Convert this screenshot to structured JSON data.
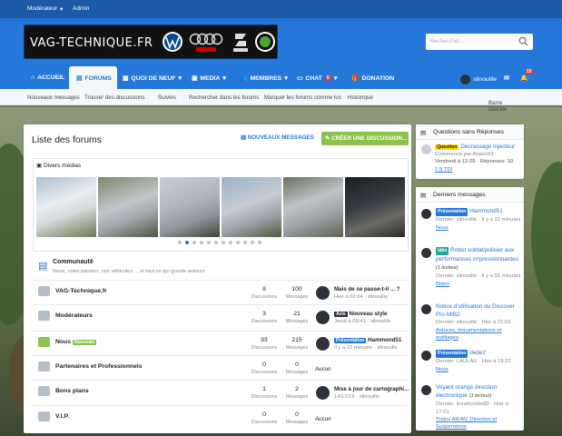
{
  "topbar": {
    "moderator": "Modérateur",
    "admin": "Admin"
  },
  "logo": {
    "text": "VAG-TECHNIQUE.FR",
    "brands": [
      "vw-logo",
      "audi-logo",
      "seat-logo",
      "skoda-logo"
    ]
  },
  "search": {
    "placeholder": "Rechercher..."
  },
  "nav": {
    "items": [
      "ACCUEIL",
      "FORUMS",
      "QUOI DE NEUF",
      "MEDIA",
      "MEMBRES",
      "CHAT",
      "DONATION"
    ],
    "chat_badge": "0",
    "user": "slinouille",
    "alert_badge": "15"
  },
  "subnav": {
    "items": [
      "Nouveaux messages",
      "Trouver des discussions",
      "Suivies",
      "Rechercher dans les forums",
      "Marquer les forums comme lus",
      "Historique"
    ],
    "sidebar_toggle": "Barre latérale"
  },
  "main": {
    "title": "Liste des forums",
    "new_messages": "NOUVEAUX MESSAGES",
    "create": "CRÉER UNE DISCUSSION...",
    "media_title": "Divers médias",
    "community_title": "Communauté",
    "community_desc": "Nous, notre passion, nos véhicules ... et tout ce qui gravite autours"
  },
  "colors": {
    "brand": "#2577d9",
    "dark": "#1c5aa7",
    "green": "#8bc34a"
  },
  "forums": [
    {
      "title": "VAG-Technique.fr",
      "tag": "",
      "discussions": "8",
      "messages": "100",
      "last_tag": "",
      "last_title": "Mais de se passe-t-il ... ?",
      "last_meta": "Hier à 02:04 · slinouille",
      "last_tagcolor": ""
    },
    {
      "title": "Modérateurs",
      "tag": "",
      "discussions": "3",
      "messages": "21",
      "last_tag": "Avis",
      "last_title": "Nouveau style",
      "last_meta": "Jeudi à 09:43 · slinouille",
      "last_tagcolor": "#2d3238"
    },
    {
      "title": "Nous",
      "tag": "Nouveau",
      "discussions": "93",
      "messages": "215",
      "last_tag": "Présentation",
      "last_title": "Hammond51",
      "last_meta": "Il y a 22 minutes · slinouille",
      "last_tagcolor": "#2577d9"
    },
    {
      "title": "Partenaires et Professionnels",
      "tag": "",
      "discussions": "0",
      "messages": "0",
      "last_tag": "",
      "last_title": "Aucun",
      "last_meta": "",
      "last_tagcolor": ""
    },
    {
      "title": "Bons plans",
      "tag": "",
      "discussions": "1",
      "messages": "2",
      "last_tag": "",
      "last_title": "Mise à jour de cartographi...",
      "last_meta": "14/12/19 · slinouille",
      "last_tagcolor": ""
    },
    {
      "title": "V.I.P.",
      "tag": "",
      "discussions": "0",
      "messages": "0",
      "last_tag": "",
      "last_title": "Aucun",
      "last_meta": "",
      "last_tagcolor": ""
    }
  ],
  "labels": {
    "discussions": "Discussions",
    "messages": "Messages"
  },
  "side_questions": {
    "title": "Questions sans Réponses",
    "tag": "Question",
    "thread": "Décrassage injecteur",
    "meta1": "Commencé par Anass93",
    "meta2": "Vendredi à 12:28 · Réponses: 10",
    "forum": "1.9 TDI"
  },
  "side_latest": {
    "title": "Derniers messages",
    "items": [
      {
        "tag": "Présentation",
        "title": "Hammond51",
        "meta": "Dernier: slinouille · Il y a 22 minutes",
        "forum": "Nous"
      },
      {
        "tag": "Idée",
        "title": "Robot soldat/policier aux performances impressionnantes",
        "readers": "(1 lecteur)",
        "meta": "Dernier: slinouille · Il y a 55 minutes",
        "forum": "Bistro"
      },
      {
        "tag": "",
        "title": "Notice d'utilisation du Discover Pro MIB2",
        "meta": "Dernier: slinouille · Hier à 21:03",
        "forum": "Astuces, documentations et outillages"
      },
      {
        "tag": "Présentation",
        "title": "dede2",
        "meta": "Dernier: LAULAU · Hier à 19:22",
        "forum": "Nous"
      },
      {
        "tag": "",
        "title": "Voyant orange direction électronique",
        "readers": "(1 lecteur)",
        "meta": "Dernier: lionelcorbie80 · Hier à 17:01",
        "forum": "Trains AR/AV, Direction et Suspensions"
      }
    ]
  }
}
